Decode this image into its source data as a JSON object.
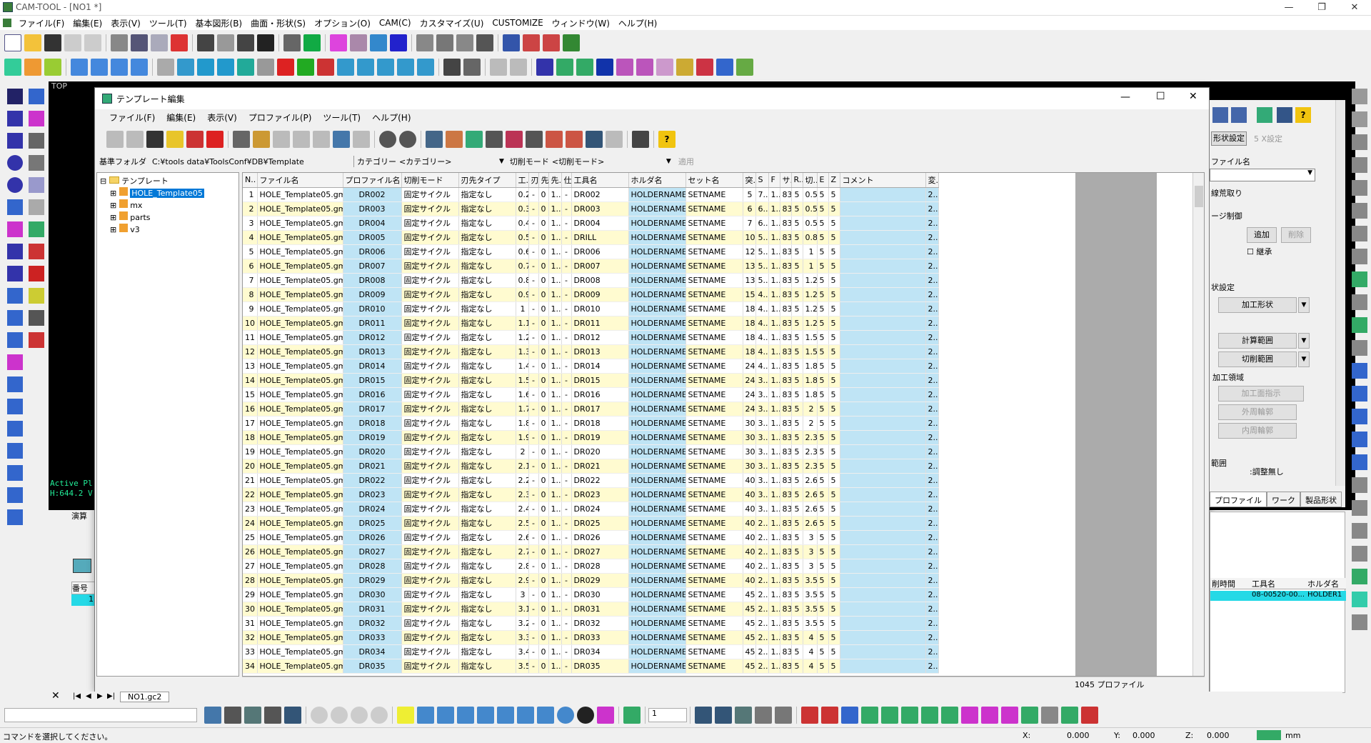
{
  "app": {
    "title": "CAM-TOOL - [NO1 *]"
  },
  "menu": [
    "ファイル(F)",
    "編集(E)",
    "表示(V)",
    "ツール(T)",
    "基本図形(B)",
    "曲面・形状(S)",
    "オプション(O)",
    "CAM(C)",
    "カスタマイズ(U)",
    "CUSTOMIZE",
    "ウィンドウ(W)",
    "ヘルプ(H)"
  ],
  "viewport": {
    "label": "TOP",
    "active_text": "Active Pl",
    "h_text": "H:644.2 V"
  },
  "dialog": {
    "title": "テンプレート編集",
    "menu": [
      "ファイル(F)",
      "編集(E)",
      "表示(V)",
      "プロファイル(P)",
      "ツール(T)",
      "ヘルプ(H)"
    ],
    "base_folder_label": "基準フォルダ",
    "base_folder_value": "C:¥tools data¥ToolsConf¥DB¥Template",
    "category_label": "カテゴリー",
    "category_value": "<カテゴリー>",
    "cut_mode_label": "切削モード",
    "cut_mode_value": "<切削モード>",
    "apply_label": "適用",
    "tree": {
      "root": "テンプレート",
      "items": [
        "HOLE_Template05",
        "mx",
        "parts",
        "v3"
      ]
    },
    "columns": [
      "N..",
      "ファイル名",
      "プロファイル名",
      "切削モード",
      "刃先タイプ",
      "工..",
      "刃..",
      "先..",
      "先..",
      "仕..",
      "工具名",
      "ホルダ名",
      "セット名",
      "突..",
      "S",
      "F",
      "サ..",
      "R..",
      "切..",
      "E",
      "Z",
      "コメント",
      "変.."
    ],
    "rows": [
      [
        "1",
        "HOLE_Template05.gmt",
        "DR002",
        "固定サイクル",
        "指定なし",
        "0.2",
        "-",
        "0",
        "1...",
        "-",
        "DR002",
        "HOLDERNAME",
        "SETNAME",
        "5",
        "7...",
        "1...",
        "83",
        "5",
        "0.5",
        "5",
        "5",
        "",
        "2..."
      ],
      [
        "2",
        "HOLE_Template05.gmt",
        "DR003",
        "固定サイクル",
        "指定なし",
        "0.3",
        "-",
        "0",
        "1...",
        "-",
        "DR003",
        "HOLDERNAME",
        "SETNAME",
        "6",
        "6...",
        "1...",
        "83",
        "5",
        "0.5",
        "5",
        "5",
        "",
        "2..."
      ],
      [
        "3",
        "HOLE_Template05.gmt",
        "DR004",
        "固定サイクル",
        "指定なし",
        "0.4",
        "-",
        "0",
        "1...",
        "-",
        "DR004",
        "HOLDERNAME",
        "SETNAME",
        "7",
        "6...",
        "1...",
        "83",
        "5",
        "0.5",
        "5",
        "5",
        "",
        "2..."
      ],
      [
        "4",
        "HOLE_Template05.gmt",
        "DR005",
        "固定サイクル",
        "指定なし",
        "0.5",
        "-",
        "0",
        "1...",
        "-",
        "DRILL",
        "HOLDERNAME",
        "SETNAME",
        "10",
        "5...",
        "1...",
        "83",
        "5",
        "0.8",
        "5",
        "5",
        "",
        "2..."
      ],
      [
        "5",
        "HOLE_Template05.gmt",
        "DR006",
        "固定サイクル",
        "指定なし",
        "0.6",
        "-",
        "0",
        "1...",
        "-",
        "DR006",
        "HOLDERNAME",
        "SETNAME",
        "12",
        "5...",
        "1...",
        "83",
        "5",
        "1",
        "5",
        "5",
        "",
        "2..."
      ],
      [
        "6",
        "HOLE_Template05.gmt",
        "DR007",
        "固定サイクル",
        "指定なし",
        "0.7",
        "-",
        "0",
        "1...",
        "-",
        "DR007",
        "HOLDERNAME",
        "SETNAME",
        "13",
        "5...",
        "1...",
        "83",
        "5",
        "1",
        "5",
        "5",
        "",
        "2..."
      ],
      [
        "7",
        "HOLE_Template05.gmt",
        "DR008",
        "固定サイクル",
        "指定なし",
        "0.8",
        "-",
        "0",
        "1...",
        "-",
        "DR008",
        "HOLDERNAME",
        "SETNAME",
        "13",
        "5...",
        "1...",
        "83",
        "5",
        "1.2",
        "5",
        "5",
        "",
        "2..."
      ],
      [
        "8",
        "HOLE_Template05.gmt",
        "DR009",
        "固定サイクル",
        "指定なし",
        "0.9",
        "-",
        "0",
        "1...",
        "-",
        "DR009",
        "HOLDERNAME",
        "SETNAME",
        "15",
        "4...",
        "1...",
        "83",
        "5",
        "1.2",
        "5",
        "5",
        "",
        "2..."
      ],
      [
        "9",
        "HOLE_Template05.gmt",
        "DR010",
        "固定サイクル",
        "指定なし",
        "1",
        "-",
        "0",
        "1...",
        "-",
        "DR010",
        "HOLDERNAME",
        "SETNAME",
        "18",
        "4...",
        "1...",
        "83",
        "5",
        "1.2",
        "5",
        "5",
        "",
        "2..."
      ],
      [
        "10",
        "HOLE_Template05.gmt",
        "DR011",
        "固定サイクル",
        "指定なし",
        "1.1",
        "-",
        "0",
        "1...",
        "-",
        "DR011",
        "HOLDERNAME",
        "SETNAME",
        "18",
        "4...",
        "1...",
        "83",
        "5",
        "1.2",
        "5",
        "5",
        "",
        "2..."
      ],
      [
        "11",
        "HOLE_Template05.gmt",
        "DR012",
        "固定サイクル",
        "指定なし",
        "1.2",
        "-",
        "0",
        "1...",
        "-",
        "DR012",
        "HOLDERNAME",
        "SETNAME",
        "18",
        "4...",
        "1...",
        "83",
        "5",
        "1.5",
        "5",
        "5",
        "",
        "2..."
      ],
      [
        "12",
        "HOLE_Template05.gmt",
        "DR013",
        "固定サイクル",
        "指定なし",
        "1.3",
        "-",
        "0",
        "1...",
        "-",
        "DR013",
        "HOLDERNAME",
        "SETNAME",
        "18",
        "4...",
        "1...",
        "83",
        "5",
        "1.5",
        "5",
        "5",
        "",
        "2..."
      ],
      [
        "13",
        "HOLE_Template05.gmt",
        "DR014",
        "固定サイクル",
        "指定なし",
        "1.4",
        "-",
        "0",
        "1...",
        "-",
        "DR014",
        "HOLDERNAME",
        "SETNAME",
        "24",
        "4...",
        "1...",
        "83",
        "5",
        "1.8",
        "5",
        "5",
        "",
        "2..."
      ],
      [
        "14",
        "HOLE_Template05.gmt",
        "DR015",
        "固定サイクル",
        "指定なし",
        "1.5",
        "-",
        "0",
        "1...",
        "-",
        "DR015",
        "HOLDERNAME",
        "SETNAME",
        "24",
        "3...",
        "1...",
        "83",
        "5",
        "1.8",
        "5",
        "5",
        "",
        "2..."
      ],
      [
        "15",
        "HOLE_Template05.gmt",
        "DR016",
        "固定サイクル",
        "指定なし",
        "1.6",
        "-",
        "0",
        "1...",
        "-",
        "DR016",
        "HOLDERNAME",
        "SETNAME",
        "24",
        "3...",
        "1...",
        "83",
        "5",
        "1.8",
        "5",
        "5",
        "",
        "2..."
      ],
      [
        "16",
        "HOLE_Template05.gmt",
        "DR017",
        "固定サイクル",
        "指定なし",
        "1.7",
        "-",
        "0",
        "1...",
        "-",
        "DR017",
        "HOLDERNAME",
        "SETNAME",
        "24",
        "3...",
        "1...",
        "83",
        "5",
        "2",
        "5",
        "5",
        "",
        "2..."
      ],
      [
        "17",
        "HOLE_Template05.gmt",
        "DR018",
        "固定サイクル",
        "指定なし",
        "1.8",
        "-",
        "0",
        "1...",
        "-",
        "DR018",
        "HOLDERNAME",
        "SETNAME",
        "30",
        "3...",
        "1...",
        "83",
        "5",
        "2",
        "5",
        "5",
        "",
        "2..."
      ],
      [
        "18",
        "HOLE_Template05.gmt",
        "DR019",
        "固定サイクル",
        "指定なし",
        "1.9",
        "-",
        "0",
        "1...",
        "-",
        "DR019",
        "HOLDERNAME",
        "SETNAME",
        "30",
        "3...",
        "1...",
        "83",
        "5",
        "2.3",
        "5",
        "5",
        "",
        "2..."
      ],
      [
        "19",
        "HOLE_Template05.gmt",
        "DR020",
        "固定サイクル",
        "指定なし",
        "2",
        "-",
        "0",
        "1...",
        "-",
        "DR020",
        "HOLDERNAME",
        "SETNAME",
        "30",
        "3...",
        "1...",
        "83",
        "5",
        "2.3",
        "5",
        "5",
        "",
        "2..."
      ],
      [
        "20",
        "HOLE_Template05.gmt",
        "DR021",
        "固定サイクル",
        "指定なし",
        "2.1",
        "-",
        "0",
        "1...",
        "-",
        "DR021",
        "HOLDERNAME",
        "SETNAME",
        "30",
        "3...",
        "1...",
        "83",
        "5",
        "2.3",
        "5",
        "5",
        "",
        "2..."
      ],
      [
        "21",
        "HOLE_Template05.gmt",
        "DR022",
        "固定サイクル",
        "指定なし",
        "2.2",
        "-",
        "0",
        "1...",
        "-",
        "DR022",
        "HOLDERNAME",
        "SETNAME",
        "40",
        "3...",
        "1...",
        "83",
        "5",
        "2.6",
        "5",
        "5",
        "",
        "2..."
      ],
      [
        "22",
        "HOLE_Template05.gmt",
        "DR023",
        "固定サイクル",
        "指定なし",
        "2.3",
        "-",
        "0",
        "1...",
        "-",
        "DR023",
        "HOLDERNAME",
        "SETNAME",
        "40",
        "3...",
        "1...",
        "83",
        "5",
        "2.6",
        "5",
        "5",
        "",
        "2..."
      ],
      [
        "23",
        "HOLE_Template05.gmt",
        "DR024",
        "固定サイクル",
        "指定なし",
        "2.4",
        "-",
        "0",
        "1...",
        "-",
        "DR024",
        "HOLDERNAME",
        "SETNAME",
        "40",
        "3...",
        "1...",
        "83",
        "5",
        "2.6",
        "5",
        "5",
        "",
        "2..."
      ],
      [
        "24",
        "HOLE_Template05.gmt",
        "DR025",
        "固定サイクル",
        "指定なし",
        "2.5",
        "-",
        "0",
        "1...",
        "-",
        "DR025",
        "HOLDERNAME",
        "SETNAME",
        "40",
        "2...",
        "1...",
        "83",
        "5",
        "2.6",
        "5",
        "5",
        "",
        "2..."
      ],
      [
        "25",
        "HOLE_Template05.gmt",
        "DR026",
        "固定サイクル",
        "指定なし",
        "2.6",
        "-",
        "0",
        "1...",
        "-",
        "DR026",
        "HOLDERNAME",
        "SETNAME",
        "40",
        "2...",
        "1...",
        "83",
        "5",
        "3",
        "5",
        "5",
        "",
        "2..."
      ],
      [
        "26",
        "HOLE_Template05.gmt",
        "DR027",
        "固定サイクル",
        "指定なし",
        "2.7",
        "-",
        "0",
        "1...",
        "-",
        "DR027",
        "HOLDERNAME",
        "SETNAME",
        "40",
        "2...",
        "1...",
        "83",
        "5",
        "3",
        "5",
        "5",
        "",
        "2..."
      ],
      [
        "27",
        "HOLE_Template05.gmt",
        "DR028",
        "固定サイクル",
        "指定なし",
        "2.8",
        "-",
        "0",
        "1...",
        "-",
        "DR028",
        "HOLDERNAME",
        "SETNAME",
        "40",
        "2...",
        "1...",
        "83",
        "5",
        "3",
        "5",
        "5",
        "",
        "2..."
      ],
      [
        "28",
        "HOLE_Template05.gmt",
        "DR029",
        "固定サイクル",
        "指定なし",
        "2.9",
        "-",
        "0",
        "1...",
        "-",
        "DR029",
        "HOLDERNAME",
        "SETNAME",
        "40",
        "2...",
        "1...",
        "83",
        "5",
        "3.5",
        "5",
        "5",
        "",
        "2..."
      ],
      [
        "29",
        "HOLE_Template05.gmt",
        "DR030",
        "固定サイクル",
        "指定なし",
        "3",
        "-",
        "0",
        "1...",
        "-",
        "DR030",
        "HOLDERNAME",
        "SETNAME",
        "45",
        "2...",
        "1...",
        "83",
        "5",
        "3.5",
        "5",
        "5",
        "",
        "2..."
      ],
      [
        "30",
        "HOLE_Template05.gmt",
        "DR031",
        "固定サイクル",
        "指定なし",
        "3.1",
        "-",
        "0",
        "1...",
        "-",
        "DR031",
        "HOLDERNAME",
        "SETNAME",
        "45",
        "2...",
        "1...",
        "83",
        "5",
        "3.5",
        "5",
        "5",
        "",
        "2..."
      ],
      [
        "31",
        "HOLE_Template05.gmt",
        "DR032",
        "固定サイクル",
        "指定なし",
        "3.2",
        "-",
        "0",
        "1...",
        "-",
        "DR032",
        "HOLDERNAME",
        "SETNAME",
        "45",
        "2...",
        "1...",
        "83",
        "5",
        "3.5",
        "5",
        "5",
        "",
        "2..."
      ],
      [
        "32",
        "HOLE_Template05.gmt",
        "DR033",
        "固定サイクル",
        "指定なし",
        "3.3",
        "-",
        "0",
        "1...",
        "-",
        "DR033",
        "HOLDERNAME",
        "SETNAME",
        "45",
        "2...",
        "1...",
        "83",
        "5",
        "4",
        "5",
        "5",
        "",
        "2..."
      ],
      [
        "33",
        "HOLE_Template05.gmt",
        "DR034",
        "固定サイクル",
        "指定なし",
        "3.4",
        "-",
        "0",
        "1...",
        "-",
        "DR034",
        "HOLDERNAME",
        "SETNAME",
        "45",
        "2...",
        "1...",
        "83",
        "5",
        "4",
        "5",
        "5",
        "",
        "2..."
      ],
      [
        "34",
        "HOLE_Template05.gmt",
        "DR035",
        "固定サイクル",
        "指定なし",
        "3.5",
        "-",
        "0",
        "1...",
        "-",
        "DR035",
        "HOLDERNAME",
        "SETNAME",
        "45",
        "2...",
        "1...",
        "83",
        "5",
        "4",
        "5",
        "5",
        "",
        "2..."
      ]
    ],
    "profile_count": "1045 プロファイル"
  },
  "right_panel": {
    "shape_settings": "形状設定",
    "five_axis": "5 X設定",
    "profile_name": "ファイル名",
    "finishing": "線荒取り",
    "stage_ctrl": "ージ制御",
    "add": "追加",
    "remove": "削除",
    "inherit": "継承",
    "cond_settings": "状設定",
    "shape": "加工形状",
    "calc_range": "計算範囲",
    "cut_range": "切削範囲",
    "region_label": "加工領域",
    "region_instruct": "加工面指示",
    "outer": "外周輪郭",
    "inner": "内周輪郭",
    "range_label": "範囲",
    "adjust": ":調整無し",
    "tabs": [
      "プロファイル",
      "ワーク",
      "製品形状"
    ],
    "col_time": "削時間",
    "col_tool": "工具名",
    "col_holder": "ホルダ名",
    "row_tool": "08-00520-00...",
    "row_holder": "HOLDER1"
  },
  "lower_left": {
    "header_no": "番号",
    "row_value": "1",
    "tab_label": "演算"
  },
  "bottom": {
    "tab": "NO1.gc2",
    "spin_value": "1"
  },
  "status": {
    "message": "コマンドを選択してください。",
    "x_label": "X:",
    "x_value": "0.000",
    "y_label": "Y:",
    "y_value": "0.000",
    "z_label": "Z:",
    "z_value": "0.000",
    "unit": "mm"
  }
}
